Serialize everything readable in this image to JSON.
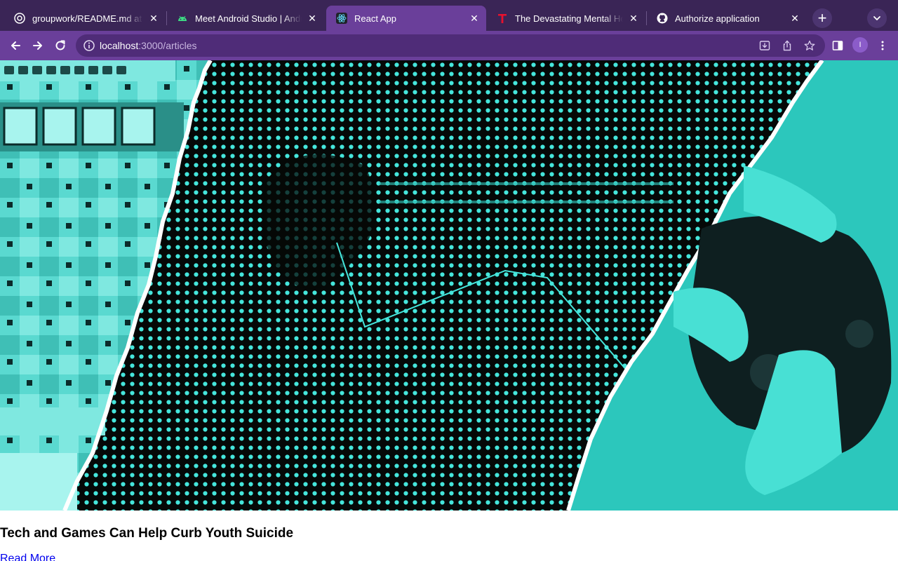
{
  "browser": {
    "tabs": [
      {
        "title": "groupwork/README.md at m",
        "favicon": "github-icon",
        "active": false
      },
      {
        "title": "Meet Android Studio  |  Andr",
        "favicon": "android-icon",
        "active": false
      },
      {
        "title": "React App",
        "favicon": "react-icon",
        "active": true
      },
      {
        "title": "The Devastating Mental Hea",
        "favicon": "t-logo-icon",
        "active": false
      },
      {
        "title": "Authorize application",
        "favicon": "github-icon",
        "active": false
      }
    ],
    "address": {
      "host": "localhost",
      "path": ":3000/articles"
    },
    "profile_initial": "I"
  },
  "article": {
    "hero_image": "Split illustration: pixel game inventory, halftone figure, hands holding a game controller",
    "title": "Tech and Games Can Help Curb Youth Suicide",
    "read_more_label": "Read More"
  },
  "colors": {
    "tab_strip": "#3a2556",
    "toolbar": "#6a3f9a",
    "omnibox": "#4f2c78",
    "image_cyan": "#45e6dc",
    "link": "#0000ee"
  }
}
